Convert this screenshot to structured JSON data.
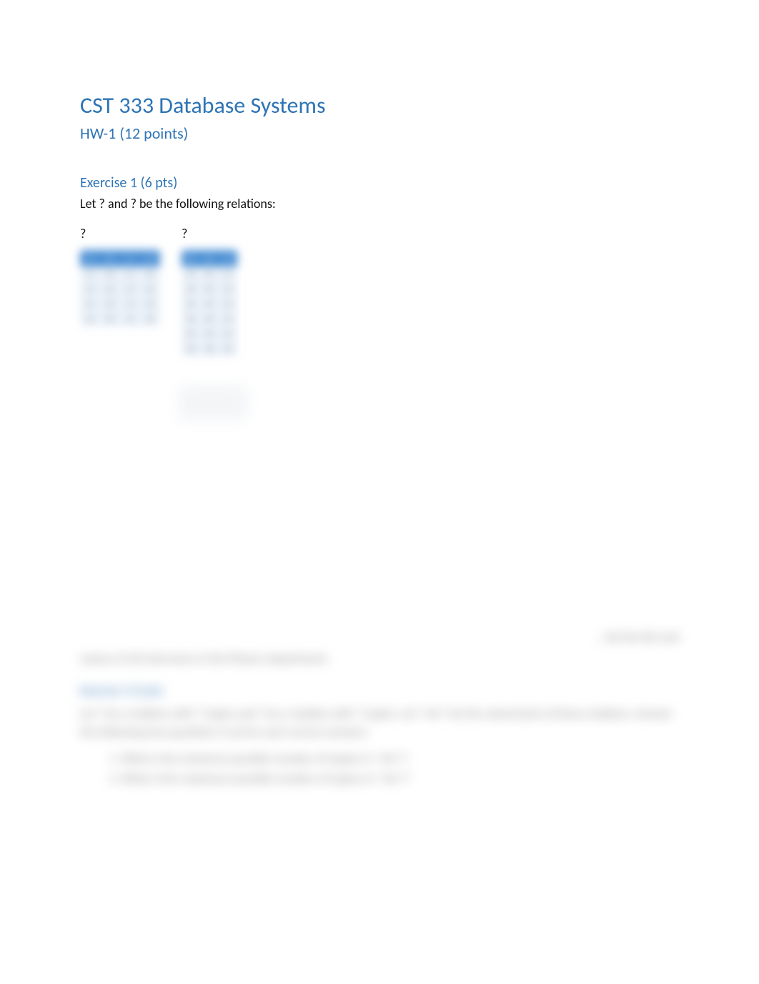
{
  "title": "CST 333 Database Systems",
  "subtitle": "HW-1 (12 points)",
  "ex1": {
    "heading": "Exercise 1 (6 pts)",
    "intro_prefix": "Let ",
    "r": "?",
    "intro_mid": " and ",
    "s": "?",
    "intro_suffix": " be the following relations:"
  },
  "tables": {
    "label_left": "?",
    "label_right": "?"
  },
  "hidden": {
    "right_frag": "… list the IDs and",
    "line1": "names of all instructors in the Physics department.",
    "ex3_head": "Exercise 3 (3 pts)",
    "parag": "Let ? be a relation with ? tuples and ? be a relation with ? tuples. Let ? ⋈ ? be the natural join of these relations. Answer the following two questions (1 pt for each correct answer):",
    "li1": "What is the minimum possible number of tuples in ? ⋈ ??",
    "li2": "What is the maximum possible number of tuples in ? ⋈ ??"
  }
}
